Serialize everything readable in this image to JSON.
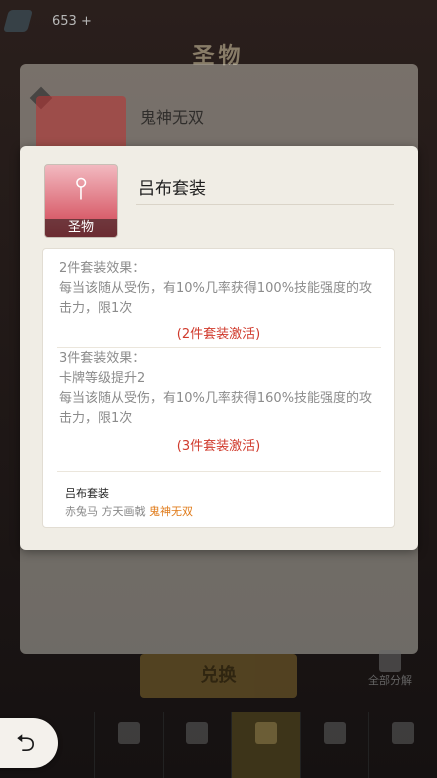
{
  "topbar": {
    "currency": "653 +"
  },
  "page_title": "圣物",
  "background_item": {
    "name": "鬼神无双"
  },
  "exchange_label": "兑换",
  "side_button_label": "全部分解",
  "nav_tabs": [
    "",
    "",
    "",
    "",
    ""
  ],
  "modal": {
    "icon_tag": "圣物",
    "title": "吕布套装",
    "effect2": {
      "heading": "2件套装效果：",
      "text": "每当该随从受伤，有10%几率获得100%技能强度的攻击力，限1次",
      "status": "(2件套装激活)"
    },
    "effect3": {
      "heading": "3件套装效果：",
      "line1": "卡牌等级提升2",
      "text": "每当该随从受伤，有10%几率获得160%技能强度的攻击力，限1次",
      "status": "(3件套装激活)"
    },
    "set": {
      "name": "吕布套装",
      "members_plain": "赤兔马 方天画戟",
      "members_highlight": "鬼神无双"
    }
  }
}
